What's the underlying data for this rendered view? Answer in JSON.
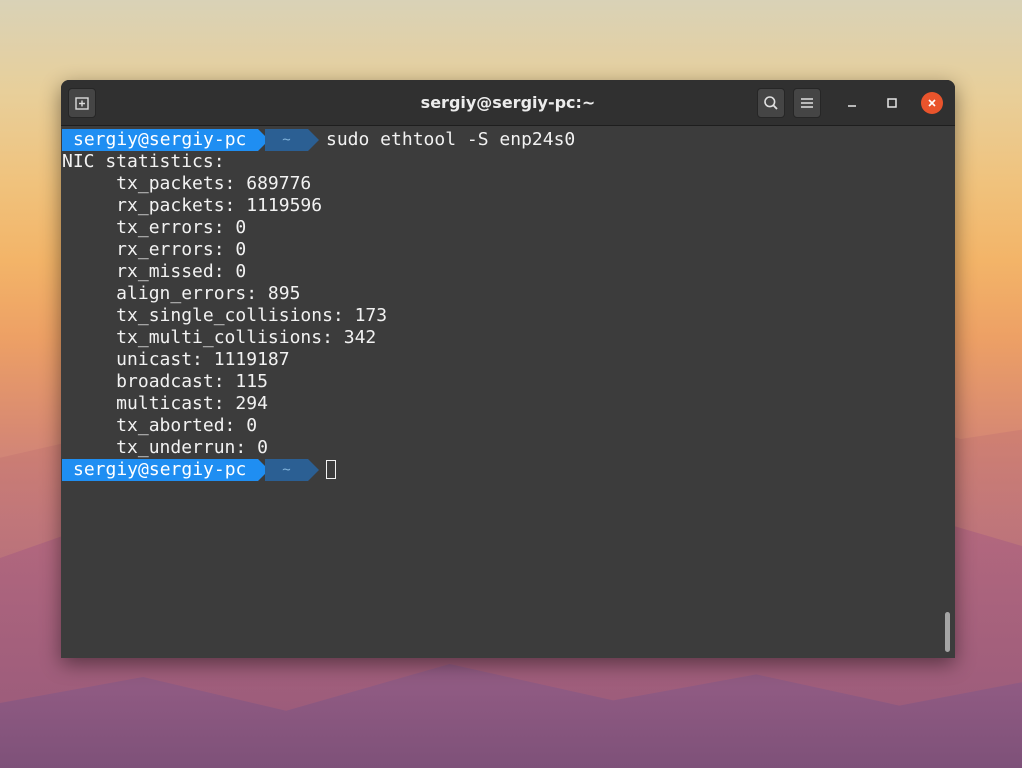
{
  "window": {
    "title": "sergiy@sergiy-pc:~"
  },
  "icons": {
    "new_tab": "new-tab-icon",
    "search": "search-icon",
    "menu": "hamburger-menu-icon",
    "minimize": "minimize-icon",
    "maximize": "maximize-icon",
    "close": "close-icon"
  },
  "colors": {
    "prompt_user_bg": "#1f8ef2",
    "prompt_dir_bg": "#2b5f93",
    "terminal_bg": "#3c3c3c",
    "close_button": "#e9542c"
  },
  "prompt": {
    "user_host": "sergiy@sergiy-pc",
    "dir": "~"
  },
  "command": "sudo ethtool -S enp24s0",
  "output": {
    "header": "NIC statistics:",
    "stats": [
      "     tx_packets: 689776",
      "     rx_packets: 1119596",
      "     tx_errors: 0",
      "     rx_errors: 0",
      "     rx_missed: 0",
      "     align_errors: 895",
      "     tx_single_collisions: 173",
      "     tx_multi_collisions: 342",
      "     unicast: 1119187",
      "     broadcast: 115",
      "     multicast: 294",
      "     tx_aborted: 0",
      "     tx_underrun: 0"
    ]
  }
}
